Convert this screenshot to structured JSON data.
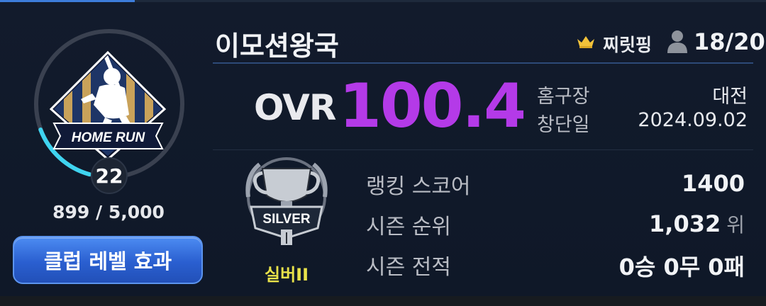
{
  "club": {
    "name": "이모션왕국",
    "owner": "찌릿핑",
    "members": "18/20",
    "level": "22",
    "exp": "899 / 5,000",
    "exp_progress": 0.18,
    "club_effect_button": "클럽 레벨 효과",
    "emblem_text": "HOME RUN"
  },
  "ovr": {
    "label": "OVR",
    "value": "100.4"
  },
  "info": {
    "home_stadium_label": "홈구장",
    "home_stadium_value": "대전",
    "founded_label": "창단일",
    "founded_value": "2024.09.02"
  },
  "tier": {
    "name": "실버II",
    "badge_text": "SILVER"
  },
  "stats": {
    "ranking_score_label": "랭킹 스코어",
    "ranking_score_value": "1400",
    "season_rank_label": "시즌 순위",
    "season_rank_value": "1,032",
    "season_rank_unit": "위",
    "season_record_label": "시즌 전적",
    "season_record_value": "0승 0무 0패"
  },
  "colors": {
    "accent_blue": "#3d7ddb",
    "ovr_purple": "#b43ae8",
    "tier_yellow": "#e8e24a",
    "progress_cyan": "#3fd4f0"
  },
  "icons": {
    "crown": "crown-icon",
    "member": "person-icon",
    "emblem": "baseball-emblem-icon",
    "trophy": "silver-trophy-icon"
  }
}
